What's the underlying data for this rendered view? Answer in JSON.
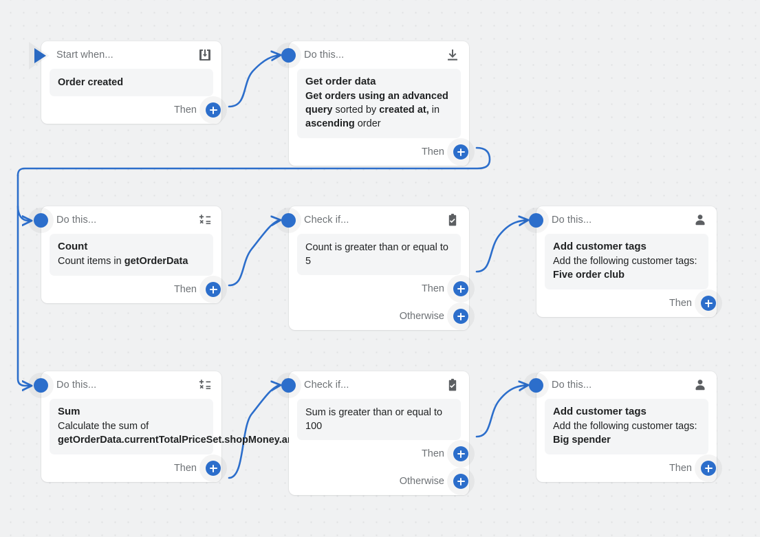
{
  "canvas": {
    "background_color": "#f0f1f2",
    "accent_color": "#2c6ecb",
    "dot_color": "#dfe1e3"
  },
  "labels": {
    "start_when": "Start when...",
    "do_this": "Do this...",
    "check_if": "Check if...",
    "then": "Then",
    "otherwise": "Otherwise"
  },
  "nodes": [
    {
      "id": "trigger",
      "kind": "trigger",
      "header": "Start when...",
      "icon": "order-created-icon",
      "title": "Order created",
      "body_lines": [],
      "outputs": [
        "Then"
      ]
    },
    {
      "id": "get-order-data",
      "kind": "action",
      "header": "Do this...",
      "icon": "get-data-icon",
      "title": "Get order data",
      "body_lines": [
        {
          "text": "Get orders using an advanced query",
          "bold": true
        },
        {
          "text": " sorted by ",
          "bold": false
        },
        {
          "text": "created at,",
          "bold": true
        },
        {
          "text": " in ",
          "bold": false
        },
        {
          "text": "ascending",
          "bold": true
        },
        {
          "text": " order",
          "bold": false
        }
      ],
      "outputs": [
        "Then"
      ]
    },
    {
      "id": "count",
      "kind": "action",
      "header": "Do this...",
      "icon": "math-operators-icon",
      "title": "Count",
      "body_lines": [
        {
          "text": "Count items in ",
          "bold": false
        },
        {
          "text": "getOrderData",
          "bold": true
        }
      ],
      "outputs": [
        "Then"
      ]
    },
    {
      "id": "check-count",
      "kind": "condition",
      "header": "Check if...",
      "icon": "clipboard-check-icon",
      "condition": "Count is greater than or equal to 5",
      "outputs": [
        "Then",
        "Otherwise"
      ]
    },
    {
      "id": "tag-five-order-club",
      "kind": "action",
      "header": "Do this...",
      "icon": "customer-icon",
      "title": "Add customer tags",
      "body_lines": [
        {
          "text": "Add the following customer tags:",
          "bold": false
        },
        {
          "text": "Five order club",
          "bold": true
        }
      ],
      "outputs": [
        "Then"
      ]
    },
    {
      "id": "sum",
      "kind": "action",
      "header": "Do this...",
      "icon": "math-operators-icon",
      "title": "Sum",
      "body_lines": [
        {
          "text": "Calculate the sum of",
          "bold": false
        },
        {
          "text": "getOrderData.currentTotalPriceSet.shopMoney.amount",
          "bold": true
        }
      ],
      "outputs": [
        "Then"
      ]
    },
    {
      "id": "check-sum",
      "kind": "condition",
      "header": "Check if...",
      "icon": "clipboard-check-icon",
      "condition": "Sum is greater than or equal to 100",
      "outputs": [
        "Then",
        "Otherwise"
      ]
    },
    {
      "id": "tag-big-spender",
      "kind": "action",
      "header": "Do this...",
      "icon": "customer-icon",
      "title": "Add customer tags",
      "body_lines": [
        {
          "text": "Add the following customer tags:",
          "bold": false
        },
        {
          "text": "Big spender",
          "bold": true
        }
      ],
      "outputs": [
        "Then"
      ]
    }
  ],
  "trigger": {
    "header": "Start when...",
    "title": "Order created",
    "then": "Then"
  },
  "get_order_data": {
    "header": "Do this...",
    "title": "Get order data",
    "seg1": "Get orders using an advanced query",
    "seg2": " sorted by ",
    "seg3": "created at,",
    "seg4": " in ",
    "seg5": "ascending",
    "seg6": " order",
    "then": "Then"
  },
  "count": {
    "header": "Do this...",
    "title": "Count",
    "seg1": "Count items in ",
    "seg2": "getOrderData",
    "then": "Then"
  },
  "check_count": {
    "header": "Check if...",
    "condition": "Count is greater than or equal to 5",
    "then": "Then",
    "otherwise": "Otherwise"
  },
  "tag_five": {
    "header": "Do this...",
    "title": "Add customer tags",
    "seg1": "Add the following customer tags:",
    "seg2": "Five order club",
    "then": "Then"
  },
  "sum": {
    "header": "Do this...",
    "title": "Sum",
    "seg1": "Calculate the sum of",
    "seg2": "getOrderData.currentTotalPriceSet.shopMoney.amount",
    "then": "Then"
  },
  "check_sum": {
    "header": "Check if...",
    "condition": "Sum is greater than or equal to 100",
    "then": "Then",
    "otherwise": "Otherwise"
  },
  "tag_big": {
    "header": "Do this...",
    "title": "Add customer tags",
    "seg1": "Add the following customer tags:",
    "seg2": "Big spender",
    "then": "Then"
  }
}
